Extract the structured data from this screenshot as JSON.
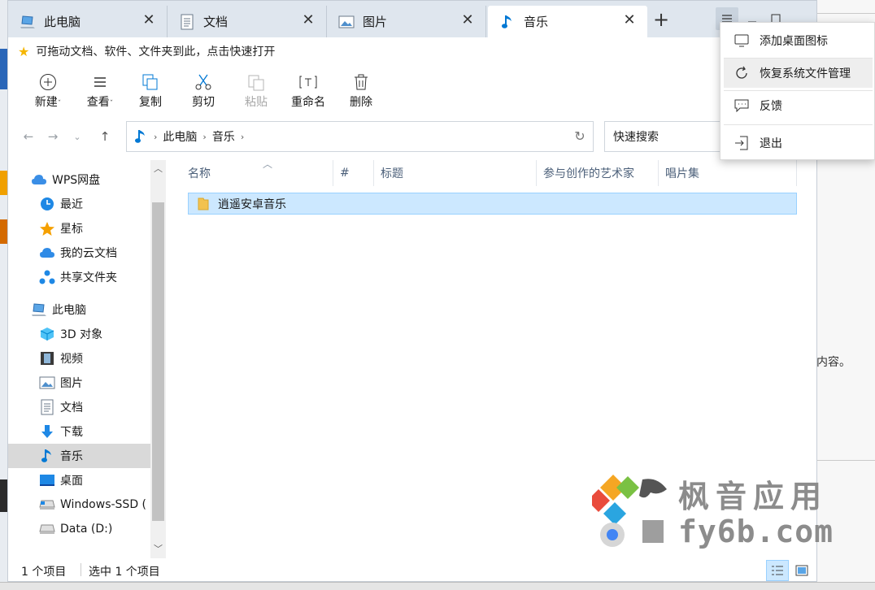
{
  "tabs": [
    {
      "label": "此电脑",
      "icon": "computer-icon",
      "active": false
    },
    {
      "label": "文档",
      "icon": "document-icon",
      "active": false
    },
    {
      "label": "图片",
      "icon": "picture-icon",
      "active": false
    },
    {
      "label": "音乐",
      "icon": "music-icon",
      "active": true
    }
  ],
  "tab_close": "✕",
  "new_tab": "+",
  "hint": {
    "text": "可拖动文档、软件、文件夹到此，点击快速打开"
  },
  "toolbar": {
    "new_label": "新建",
    "view_label": "查看",
    "copy_label": "复制",
    "cut_label": "剪切",
    "paste_label": "粘贴",
    "rename_label": "重命名",
    "delete_label": "删除"
  },
  "address": {
    "crumbs": [
      "此电脑",
      "音乐"
    ],
    "separator": "›"
  },
  "search": {
    "placeholder": "快速搜索"
  },
  "sidebar": {
    "items": [
      {
        "label": "WPS网盘",
        "icon": "cloud-icon"
      },
      {
        "label": "最近",
        "icon": "clock-icon"
      },
      {
        "label": "星标",
        "icon": "star-icon"
      },
      {
        "label": "我的云文档",
        "icon": "cloud-doc-icon"
      },
      {
        "label": "共享文件夹",
        "icon": "share-icon"
      },
      {
        "label": "此电脑",
        "icon": "computer-icon"
      },
      {
        "label": "3D 对象",
        "icon": "cube-icon"
      },
      {
        "label": "视频",
        "icon": "video-icon"
      },
      {
        "label": "图片",
        "icon": "picture-icon"
      },
      {
        "label": "文档",
        "icon": "document-icon"
      },
      {
        "label": "下载",
        "icon": "download-icon"
      },
      {
        "label": "音乐",
        "icon": "music-icon",
        "selected": true
      },
      {
        "label": "桌面",
        "icon": "desktop-icon"
      },
      {
        "label": "Windows-SSD (",
        "icon": "drive-icon"
      },
      {
        "label": "Data (D:)",
        "icon": "drive-icon"
      }
    ]
  },
  "columns": [
    "名称",
    "#",
    "标题",
    "参与创作的艺术家",
    "唱片集"
  ],
  "files": [
    {
      "name": "逍遥安卓音乐",
      "icon": "folder-icon",
      "selected": true
    }
  ],
  "status": {
    "count": "1 个项目",
    "selected": "选中 1 个项目"
  },
  "menu": {
    "items": [
      {
        "label": "添加桌面图标",
        "icon": "desktop-add-icon"
      },
      {
        "label": "恢复系统文件管理",
        "icon": "restore-icon"
      },
      {
        "label": "反馈",
        "icon": "feedback-icon"
      },
      {
        "label": "退出",
        "icon": "exit-icon"
      }
    ]
  },
  "background": {
    "right_text": "内容。"
  },
  "watermark": {
    "line1": "枫音应用",
    "line2": "fy6b.com"
  },
  "colors": {
    "accent": "#0078d4",
    "selection": "#cce8ff",
    "tabbar": "#dfe6ee",
    "folder": "#f2c24f"
  }
}
